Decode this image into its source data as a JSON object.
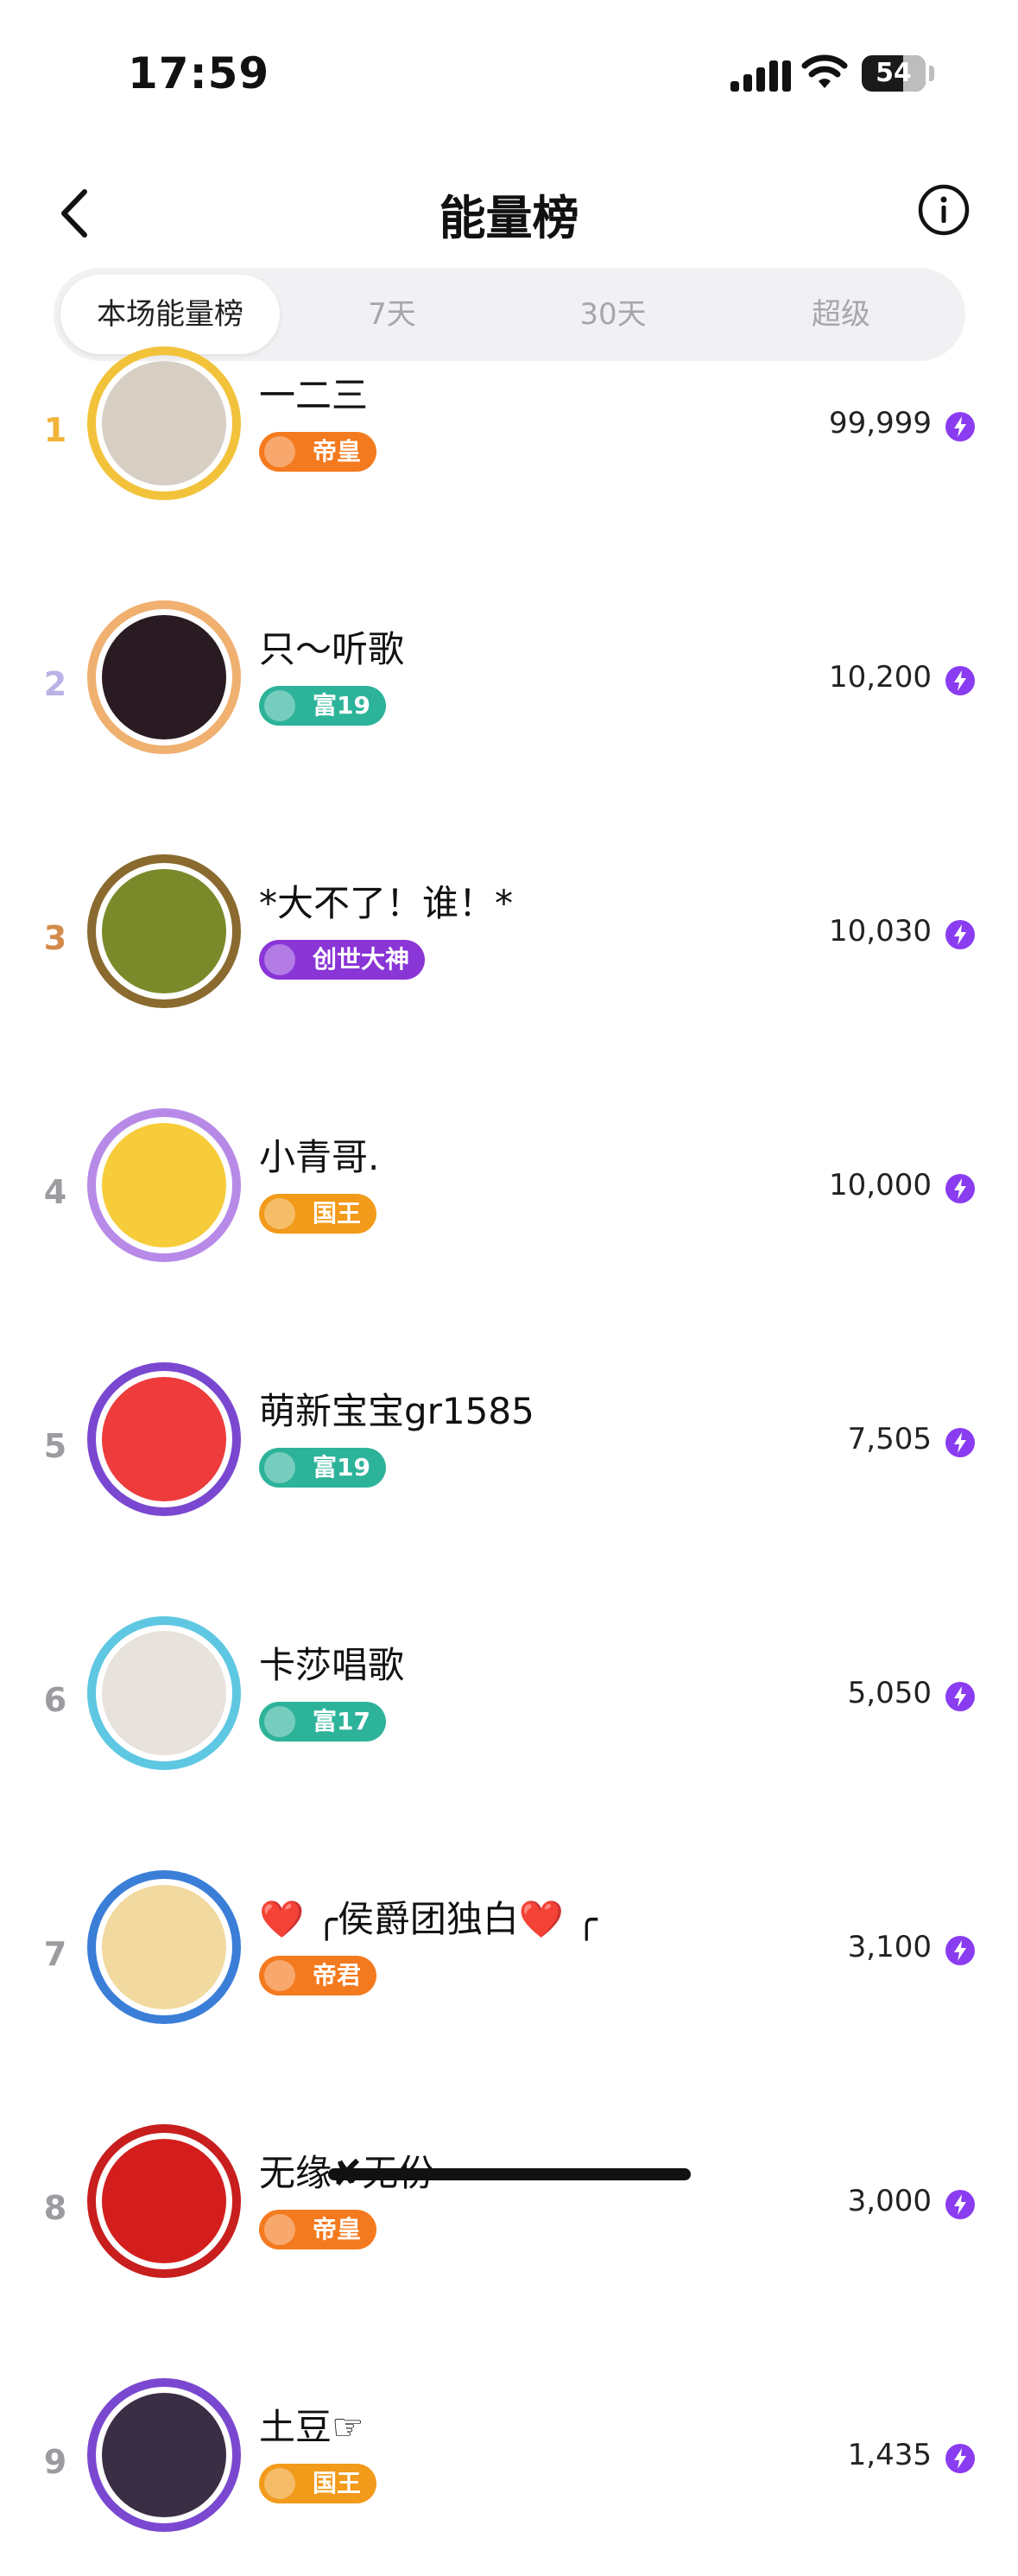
{
  "status_bar": {
    "time": "17:59",
    "battery": "54"
  },
  "header": {
    "title": "能量榜"
  },
  "tabs": [
    {
      "label": "本场能量榜",
      "active": true
    },
    {
      "label": "7天",
      "active": false
    },
    {
      "label": "30天",
      "active": false
    },
    {
      "label": "超级",
      "active": false
    }
  ],
  "ranking": [
    {
      "rank": "1",
      "name": "一二三",
      "badge": "帝皇",
      "score": "99,999",
      "rank_color": "#f2b43b",
      "badge_color": "#f47a1f"
    },
    {
      "rank": "2",
      "name": "只～听歌",
      "badge": "富19",
      "score": "10,200",
      "rank_color": "#b9b3e6",
      "badge_color": "#2db39a"
    },
    {
      "rank": "3",
      "name": "*大不了！谁！*",
      "badge": "创世大神",
      "score": "10,030",
      "rank_color": "#d28a4a",
      "badge_color": "#8a35d6"
    },
    {
      "rank": "4",
      "name": "小青哥.",
      "badge": "国王",
      "score": "10,000",
      "rank_color": "#9b9ba0",
      "badge_color": "#f29a1a"
    },
    {
      "rank": "5",
      "name": "萌新宝宝gr1585",
      "badge": "富19",
      "score": "7,505",
      "rank_color": "#9b9ba0",
      "badge_color": "#2db39a"
    },
    {
      "rank": "6",
      "name": "卡莎唱歌",
      "badge": "富17",
      "score": "5,050",
      "rank_color": "#9b9ba0",
      "badge_color": "#2db39a"
    },
    {
      "rank": "7",
      "name": "❤️ ╭侯爵团独白❤️ ╭",
      "badge": "帝君",
      "score": "3,100",
      "rank_color": "#9b9ba0",
      "badge_color": "#f47a1f"
    },
    {
      "rank": "8",
      "name": "无缘✘无份",
      "badge": "帝皇",
      "score": "3,000",
      "rank_color": "#9b9ba0",
      "badge_color": "#f47a1f"
    },
    {
      "rank": "9",
      "name": "土豆☞",
      "badge": "国王",
      "score": "1,435",
      "rank_color": "#9b9ba0",
      "badge_color": "#f29a1a"
    }
  ],
  "colors": {
    "energy_gem": "#8a3cf0"
  }
}
